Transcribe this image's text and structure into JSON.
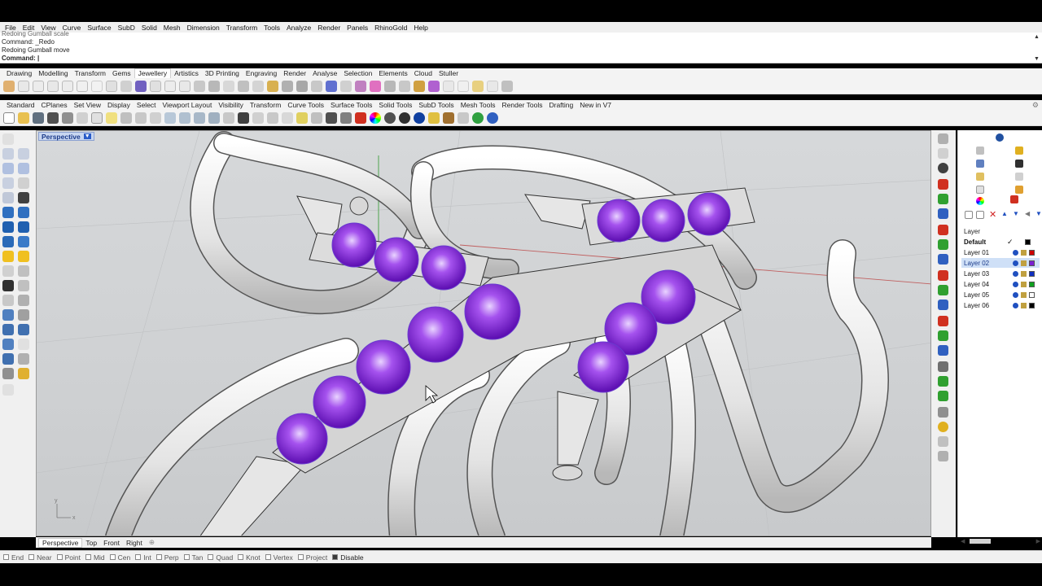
{
  "menu": [
    "File",
    "Edit",
    "View",
    "Curve",
    "Surface",
    "SubD",
    "Solid",
    "Mesh",
    "Dimension",
    "Transform",
    "Tools",
    "Analyze",
    "Render",
    "Panels",
    "RhinoGold",
    "Help"
  ],
  "command_history": [
    "Redoing Gumball scale",
    "Command: _Redo",
    "Redoing Gumball move"
  ],
  "command_prompt": "Command: |",
  "tabs_row1": [
    "Drawing",
    "Modelling",
    "Transform",
    "Gems",
    "Jewellery",
    "Artistics",
    "3D Printing",
    "Engraving",
    "Render",
    "Analyse",
    "Selection",
    "Elements",
    "Cloud",
    "Stuller"
  ],
  "tabs_row1_active": "Jewellery",
  "tabs_row2": [
    "Standard",
    "CPlanes",
    "Set View",
    "Display",
    "Select",
    "Viewport Layout",
    "Visibility",
    "Transform",
    "Curve Tools",
    "Surface Tools",
    "Solid Tools",
    "SubD Tools",
    "Mesh Tools",
    "Render Tools",
    "Drafting",
    "New in V7"
  ],
  "viewport": {
    "label": "Perspective",
    "axis_x": "x",
    "axis_y": "y"
  },
  "layers": {
    "title": "Layer",
    "items": [
      {
        "name": "Default",
        "color": "#000000",
        "current": true
      },
      {
        "name": "Layer 01",
        "color": "#cc0000",
        "current": false
      },
      {
        "name": "Layer 02",
        "color": "#7a1fd1",
        "current": false,
        "selected": true
      },
      {
        "name": "Layer 03",
        "color": "#1030c0",
        "current": false
      },
      {
        "name": "Layer 04",
        "color": "#10a020",
        "current": false
      },
      {
        "name": "Layer 05",
        "color": "#ffffff",
        "current": false
      },
      {
        "name": "Layer 06",
        "color": "#000000",
        "current": false
      }
    ]
  },
  "viewport_tabs": [
    "Perspective",
    "Top",
    "Front",
    "Right"
  ],
  "viewport_tabs_active": "Perspective",
  "osnaps": [
    {
      "label": "End",
      "on": false
    },
    {
      "label": "Near",
      "on": false
    },
    {
      "label": "Point",
      "on": false
    },
    {
      "label": "Mid",
      "on": false
    },
    {
      "label": "Cen",
      "on": false
    },
    {
      "label": "Int",
      "on": false
    },
    {
      "label": "Perp",
      "on": false
    },
    {
      "label": "Tan",
      "on": false
    },
    {
      "label": "Quad",
      "on": false
    },
    {
      "label": "Knot",
      "on": false
    },
    {
      "label": "Vertex",
      "on": false
    },
    {
      "label": "Project",
      "on": false
    },
    {
      "label": "Disable",
      "on": true
    }
  ],
  "colors": {
    "gem": "#8a2be2",
    "metal": "#e8e8e8",
    "accent": "#2a5cc8"
  }
}
